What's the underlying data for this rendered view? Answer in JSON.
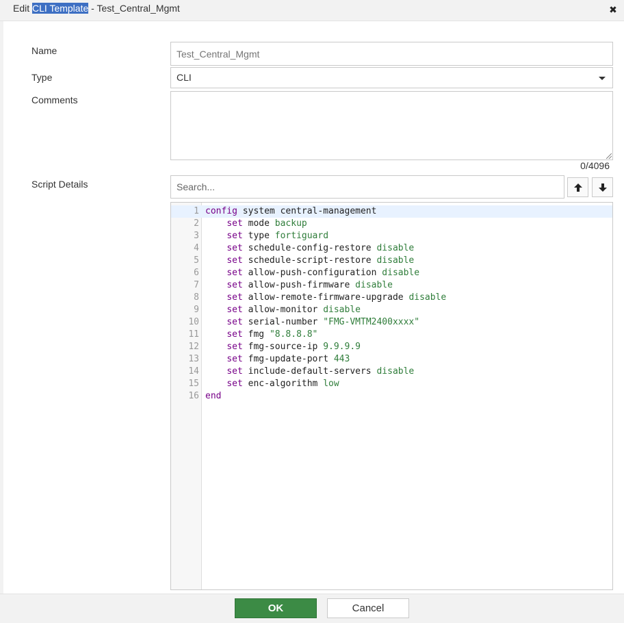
{
  "dialog": {
    "title_prefix": "Edit ",
    "title_highlight": "CLI Template",
    "title_suffix": " - Test_Central_Mgmt",
    "close_glyph": "✖"
  },
  "form": {
    "name_label": "Name",
    "name_placeholder": "Test_Central_Mgmt",
    "type_label": "Type",
    "type_value": "CLI",
    "comments_label": "Comments",
    "comments_value": "",
    "comments_counter": "0/4096",
    "script_label": "Script Details",
    "search_placeholder": "Search..."
  },
  "script": {
    "lines": [
      {
        "n": "1",
        "parts": [
          {
            "t": "config",
            "c": "kw"
          },
          {
            "t": " system central-management",
            "c": ""
          }
        ]
      },
      {
        "n": "2",
        "parts": [
          {
            "t": "    ",
            "c": ""
          },
          {
            "t": "set",
            "c": "kw"
          },
          {
            "t": " mode ",
            "c": ""
          },
          {
            "t": "backup",
            "c": "val"
          }
        ]
      },
      {
        "n": "3",
        "parts": [
          {
            "t": "    ",
            "c": ""
          },
          {
            "t": "set",
            "c": "kw"
          },
          {
            "t": " type ",
            "c": ""
          },
          {
            "t": "fortiguard",
            "c": "val"
          }
        ]
      },
      {
        "n": "4",
        "parts": [
          {
            "t": "    ",
            "c": ""
          },
          {
            "t": "set",
            "c": "kw"
          },
          {
            "t": " schedule-config-restore ",
            "c": ""
          },
          {
            "t": "disable",
            "c": "val"
          }
        ]
      },
      {
        "n": "5",
        "parts": [
          {
            "t": "    ",
            "c": ""
          },
          {
            "t": "set",
            "c": "kw"
          },
          {
            "t": " schedule-script-restore ",
            "c": ""
          },
          {
            "t": "disable",
            "c": "val"
          }
        ]
      },
      {
        "n": "6",
        "parts": [
          {
            "t": "    ",
            "c": ""
          },
          {
            "t": "set",
            "c": "kw"
          },
          {
            "t": " allow-push-configuration ",
            "c": ""
          },
          {
            "t": "disable",
            "c": "val"
          }
        ]
      },
      {
        "n": "7",
        "parts": [
          {
            "t": "    ",
            "c": ""
          },
          {
            "t": "set",
            "c": "kw"
          },
          {
            "t": " allow-push-firmware ",
            "c": ""
          },
          {
            "t": "disable",
            "c": "val"
          }
        ]
      },
      {
        "n": "8",
        "parts": [
          {
            "t": "    ",
            "c": ""
          },
          {
            "t": "set",
            "c": "kw"
          },
          {
            "t": " allow-remote-firmware-upgrade ",
            "c": ""
          },
          {
            "t": "disable",
            "c": "val"
          }
        ]
      },
      {
        "n": "9",
        "parts": [
          {
            "t": "    ",
            "c": ""
          },
          {
            "t": "set",
            "c": "kw"
          },
          {
            "t": " allow-monitor ",
            "c": ""
          },
          {
            "t": "disable",
            "c": "val"
          }
        ]
      },
      {
        "n": "10",
        "parts": [
          {
            "t": "    ",
            "c": ""
          },
          {
            "t": "set",
            "c": "kw"
          },
          {
            "t": " serial-number ",
            "c": ""
          },
          {
            "t": "\"FMG-VMTM2400xxxx\"",
            "c": "str"
          }
        ]
      },
      {
        "n": "11",
        "parts": [
          {
            "t": "    ",
            "c": ""
          },
          {
            "t": "set",
            "c": "kw"
          },
          {
            "t": " fmg ",
            "c": ""
          },
          {
            "t": "\"8.8.8.8\"",
            "c": "str"
          }
        ]
      },
      {
        "n": "12",
        "parts": [
          {
            "t": "    ",
            "c": ""
          },
          {
            "t": "set",
            "c": "kw"
          },
          {
            "t": " fmg-source-ip ",
            "c": ""
          },
          {
            "t": "9.9.9.9",
            "c": "val"
          }
        ]
      },
      {
        "n": "13",
        "parts": [
          {
            "t": "    ",
            "c": ""
          },
          {
            "t": "set",
            "c": "kw"
          },
          {
            "t": " fmg-update-port ",
            "c": ""
          },
          {
            "t": "443",
            "c": "val"
          }
        ]
      },
      {
        "n": "14",
        "parts": [
          {
            "t": "    ",
            "c": ""
          },
          {
            "t": "set",
            "c": "kw"
          },
          {
            "t": " include-default-servers ",
            "c": ""
          },
          {
            "t": "disable",
            "c": "val"
          }
        ]
      },
      {
        "n": "15",
        "parts": [
          {
            "t": "    ",
            "c": ""
          },
          {
            "t": "set",
            "c": "kw"
          },
          {
            "t": " enc-algorithm ",
            "c": ""
          },
          {
            "t": "low",
            "c": "val"
          }
        ]
      },
      {
        "n": "16",
        "parts": [
          {
            "t": "end",
            "c": "kw"
          }
        ]
      }
    ]
  },
  "footer": {
    "ok_label": "OK",
    "cancel_label": "Cancel"
  },
  "colors": {
    "title_highlight": "#3d6fc3",
    "ok_button": "#3c8b45",
    "keyword": "#770088",
    "value": "#2f7d3a"
  },
  "icons": {
    "close": "close-icon",
    "search_up": "arrow-up-icon",
    "search_down": "arrow-down-icon",
    "dropdown": "chevron-down-icon"
  }
}
